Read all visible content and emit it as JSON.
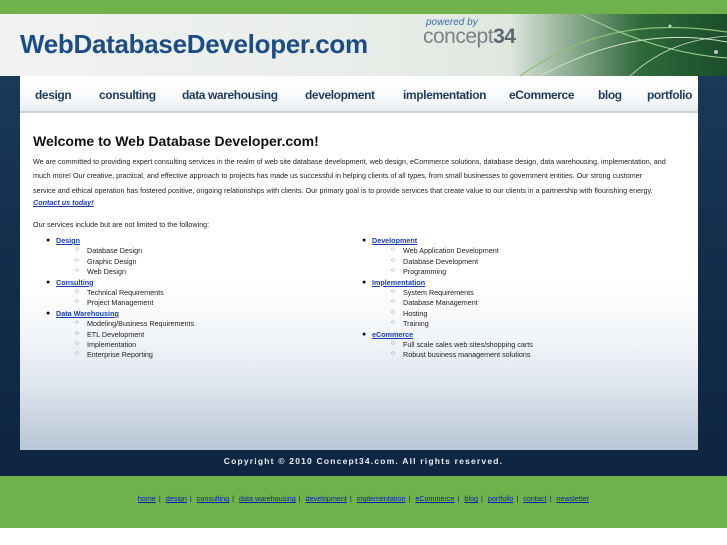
{
  "header": {
    "logo_text": "WebDatabaseDeveloper.com",
    "powered_by": "powered by",
    "brand_word": "concept",
    "brand_num": "34"
  },
  "nav": {
    "items": [
      "design",
      "consulting",
      "data warehousing",
      "development",
      "implementation",
      "eCommerce",
      "blog",
      "portfolio"
    ]
  },
  "main": {
    "title": "Welcome to Web Database Developer.com!",
    "intro_lines": [
      "We are committed to providing expert consulting services in the realm of web site database development, web design, eCommerce solutions, database design, data warehousing, implementation, and",
      "much more!  Our creative, practical, and effective approach to projects has made us successful in helping clients of all types, from small businesses to government entities.  Our strong customer",
      "service and ethical operation has fostered positive, ongoing relationships with clients.  Our primary goal is to provide services that create value to our clients in a partnership with flourishing energy."
    ],
    "contact_link": "Contact us today!",
    "services_lead": "Our services include but are not limited to the following:",
    "services_left": [
      {
        "name": "Design",
        "items": [
          "Database Design",
          "Graphic Design",
          "Web Design"
        ]
      },
      {
        "name": "Consulting",
        "items": [
          "Technical Requirements",
          "Project Management"
        ]
      },
      {
        "name": "Data Warehousing",
        "items": [
          "Modeling/Business Requirements",
          "ETL Development",
          "Implementation",
          "Enterprise Reporting"
        ]
      }
    ],
    "services_right": [
      {
        "name": "Development",
        "items": [
          "Web Application Development",
          "Database Development",
          "Programming"
        ]
      },
      {
        "name": "Implementation",
        "items": [
          "System Requirements",
          "Database Management",
          "Hosting",
          "Training"
        ]
      },
      {
        "name": "eCommerce",
        "items": [
          "Full scale sales web sites/shopping carts",
          "Robust business management solutions"
        ]
      }
    ]
  },
  "footer": {
    "copyright": "Copyright © 2010 Concept34.com.  All rights reserved.",
    "links": [
      "home",
      "design",
      "consulting",
      "data warehousing",
      "development",
      "implementation",
      "eCommerce",
      "blog",
      "portfolio",
      "contact",
      "newsletter"
    ],
    "separator": "|"
  },
  "colors": {
    "green_band": "#6fb14b",
    "navy_frame": "#14314f",
    "logo_blue": "#1c4d86",
    "link_blue": "#1a3fb0"
  }
}
